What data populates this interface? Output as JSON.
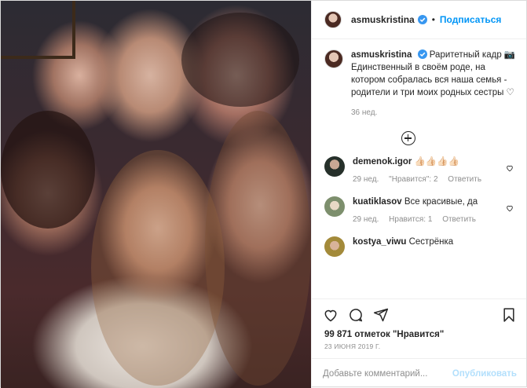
{
  "post": {
    "username": "asmuskristina",
    "follow_label": "Подписаться",
    "more_label": "•••",
    "dot": "•",
    "caption_text": "Раритетный кадр 📷 Единственный в своём роде, на котором собралась вся наша семья - родители и три моих родных сестры ♡",
    "caption_time": "36 нед.",
    "likes": "99 871 отметок \"Нравится\"",
    "date": "23 ИЮНЯ 2019 Г.",
    "add_comment_placeholder": "Добавьте комментарий...",
    "publish_label": "Опубликовать"
  },
  "comments": [
    {
      "user": "demenok.igor",
      "text": "👍🏻👍🏻👍🏻👍🏻",
      "time": "29 нед.",
      "likes": "\"Нравится\": 2",
      "reply": "Ответить"
    },
    {
      "user": "kuatiklasov",
      "text": "Все красивые, да",
      "time": "29 нед.",
      "likes": "Нравится: 1",
      "reply": "Ответить"
    },
    {
      "user": "kostya_viwu",
      "text": "Сестрёнка",
      "time": "",
      "likes": "",
      "reply": ""
    }
  ],
  "icons": {
    "verified": "verified-badge-icon",
    "heart": "heart-icon",
    "comment": "comment-icon",
    "share": "share-icon",
    "bookmark": "bookmark-icon",
    "add_more_comments": "plus-circle-icon"
  },
  "colors": {
    "accent": "#0095f6",
    "muted": "#8e8e8e",
    "publish_disabled": "#b2dffc"
  }
}
